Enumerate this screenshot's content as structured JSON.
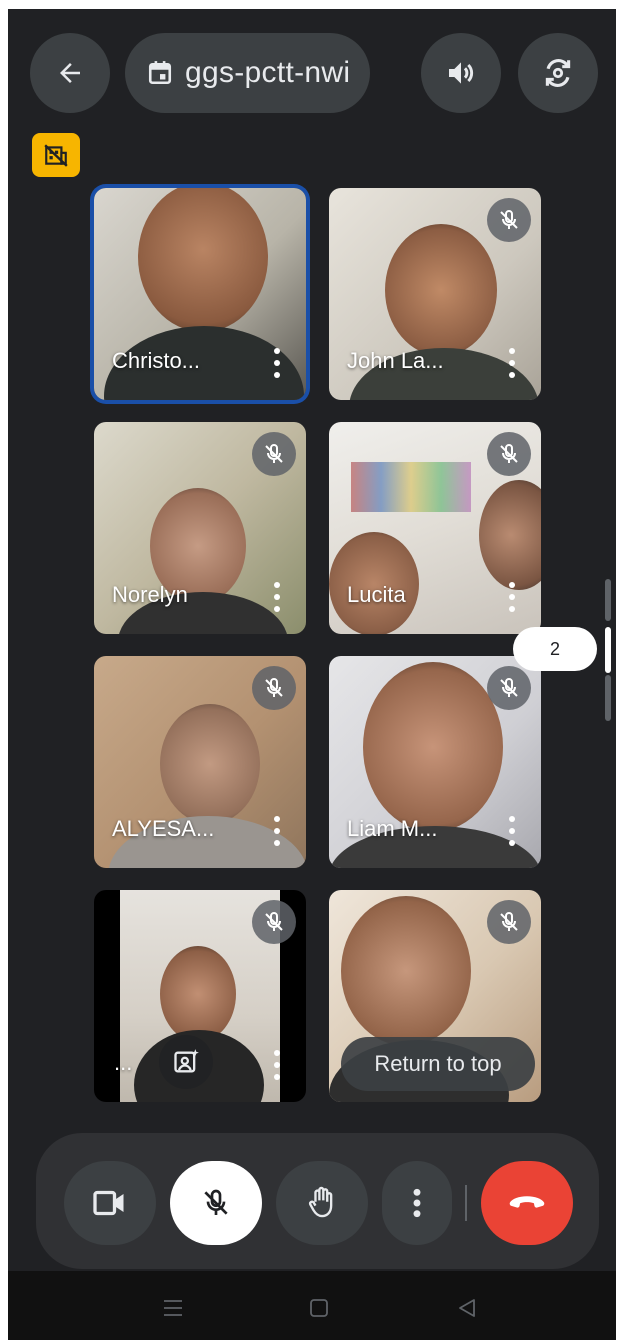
{
  "header": {
    "back_icon": "arrow-left-icon",
    "meeting_code": "ggs-pctt-nwi",
    "calendar_icon": "calendar-icon",
    "speaker_icon": "speaker-icon",
    "flip_camera_icon": "flip-camera-icon"
  },
  "notice_badge": {
    "icon": "no-video-building-icon",
    "color": "#f7b500"
  },
  "participants": [
    {
      "name": "Christo...",
      "muted": false,
      "active": true
    },
    {
      "name": "John La...",
      "muted": true,
      "active": false
    },
    {
      "name": "Norelyn",
      "muted": true,
      "active": false
    },
    {
      "name": "Lucita",
      "muted": true,
      "active": false
    },
    {
      "name": "ALYESA...",
      "muted": true,
      "active": false
    },
    {
      "name": "Liam M...",
      "muted": true,
      "active": false
    },
    {
      "name": "...",
      "muted": true,
      "active": false
    },
    {
      "name": "",
      "muted": true,
      "active": false
    }
  ],
  "pager": {
    "page": "2"
  },
  "return_to_top": "Return to top",
  "controls": {
    "camera_icon": "video-camera-icon",
    "mic_icon": "mic-off-icon",
    "hand_icon": "raise-hand-icon",
    "more_icon": "more-vert-icon",
    "end_call_icon": "end-call-icon",
    "end_color": "#ea4335"
  },
  "android_nav": {
    "recent": "menu-icon",
    "home": "home-icon",
    "back": "back-triangle-icon"
  }
}
